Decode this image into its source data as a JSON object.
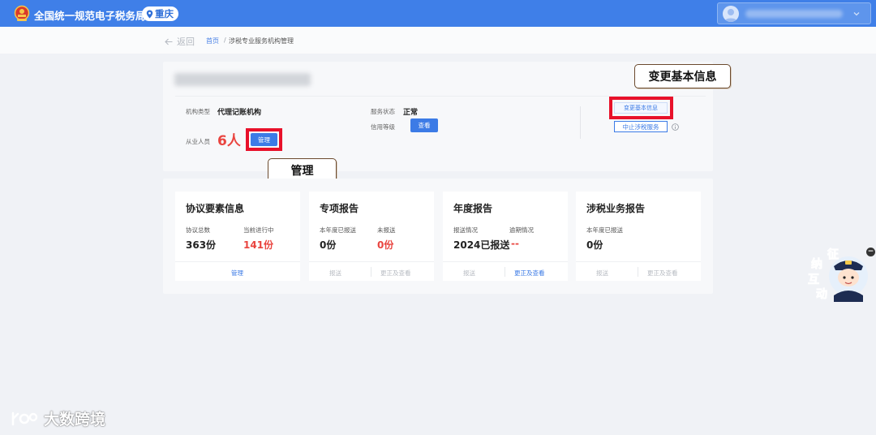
{
  "header": {
    "app_title": "全国统一规范电子税务局",
    "region": "重庆",
    "brand_color": "#3f7fe8"
  },
  "breadcrumb": {
    "back_label": "返回",
    "home": "首页",
    "separator": "/",
    "current": "涉税专业服务机构管理"
  },
  "org_info": {
    "type_label": "机构类型",
    "type_value": "代理记账机构",
    "staff_label": "从业人员",
    "staff_count": "6人",
    "manage_button": "管理",
    "status_label": "服务状态",
    "status_value": "正常",
    "credit_label": "信用等级",
    "credit_button": "查看",
    "change_info_link": "变更基本信息",
    "stop_service_button": "中止涉税服务"
  },
  "callouts": {
    "change_info": "变更基本信息",
    "manage": "管理"
  },
  "cards": [
    {
      "title": "协议要素信息",
      "items": [
        {
          "label": "协议总数",
          "value": "363份",
          "color": "#222222"
        },
        {
          "label": "当前进行中",
          "value": "141份",
          "color": "#e9443f"
        }
      ],
      "actions": [
        {
          "label": "管理",
          "enabled": true
        }
      ]
    },
    {
      "title": "专项报告",
      "items": [
        {
          "label": "本年度已报送",
          "value": "0份",
          "color": "#222222"
        },
        {
          "label": "未报送",
          "value": "0份",
          "color": "#e9443f"
        }
      ],
      "actions": [
        {
          "label": "报送",
          "enabled": false
        },
        {
          "label": "更正及查看",
          "enabled": false
        }
      ]
    },
    {
      "title": "年度报告",
      "items": [
        {
          "label": "报送情况",
          "value": "2024已报送",
          "color": "#222222"
        },
        {
          "label": "逾期情况",
          "value": "--",
          "color": "#e9443f"
        }
      ],
      "actions": [
        {
          "label": "报送",
          "enabled": false
        },
        {
          "label": "更正及查看",
          "enabled": true
        }
      ]
    },
    {
      "title": "涉税业务报告",
      "items": [
        {
          "label": "本年度已报送",
          "value": "0份",
          "color": "#222222"
        }
      ],
      "actions": [
        {
          "label": "报送",
          "enabled": false
        },
        {
          "label": "更正及查看",
          "enabled": false
        }
      ]
    }
  ],
  "assistant": {
    "chars": [
      "征",
      "纳",
      "互",
      "动"
    ],
    "close_symbol": "−"
  },
  "watermark": {
    "text": "大数跨境"
  },
  "colors": {
    "accent": "#3c7be6",
    "highlight_red": "#e8112a",
    "value_red": "#e9443f"
  }
}
